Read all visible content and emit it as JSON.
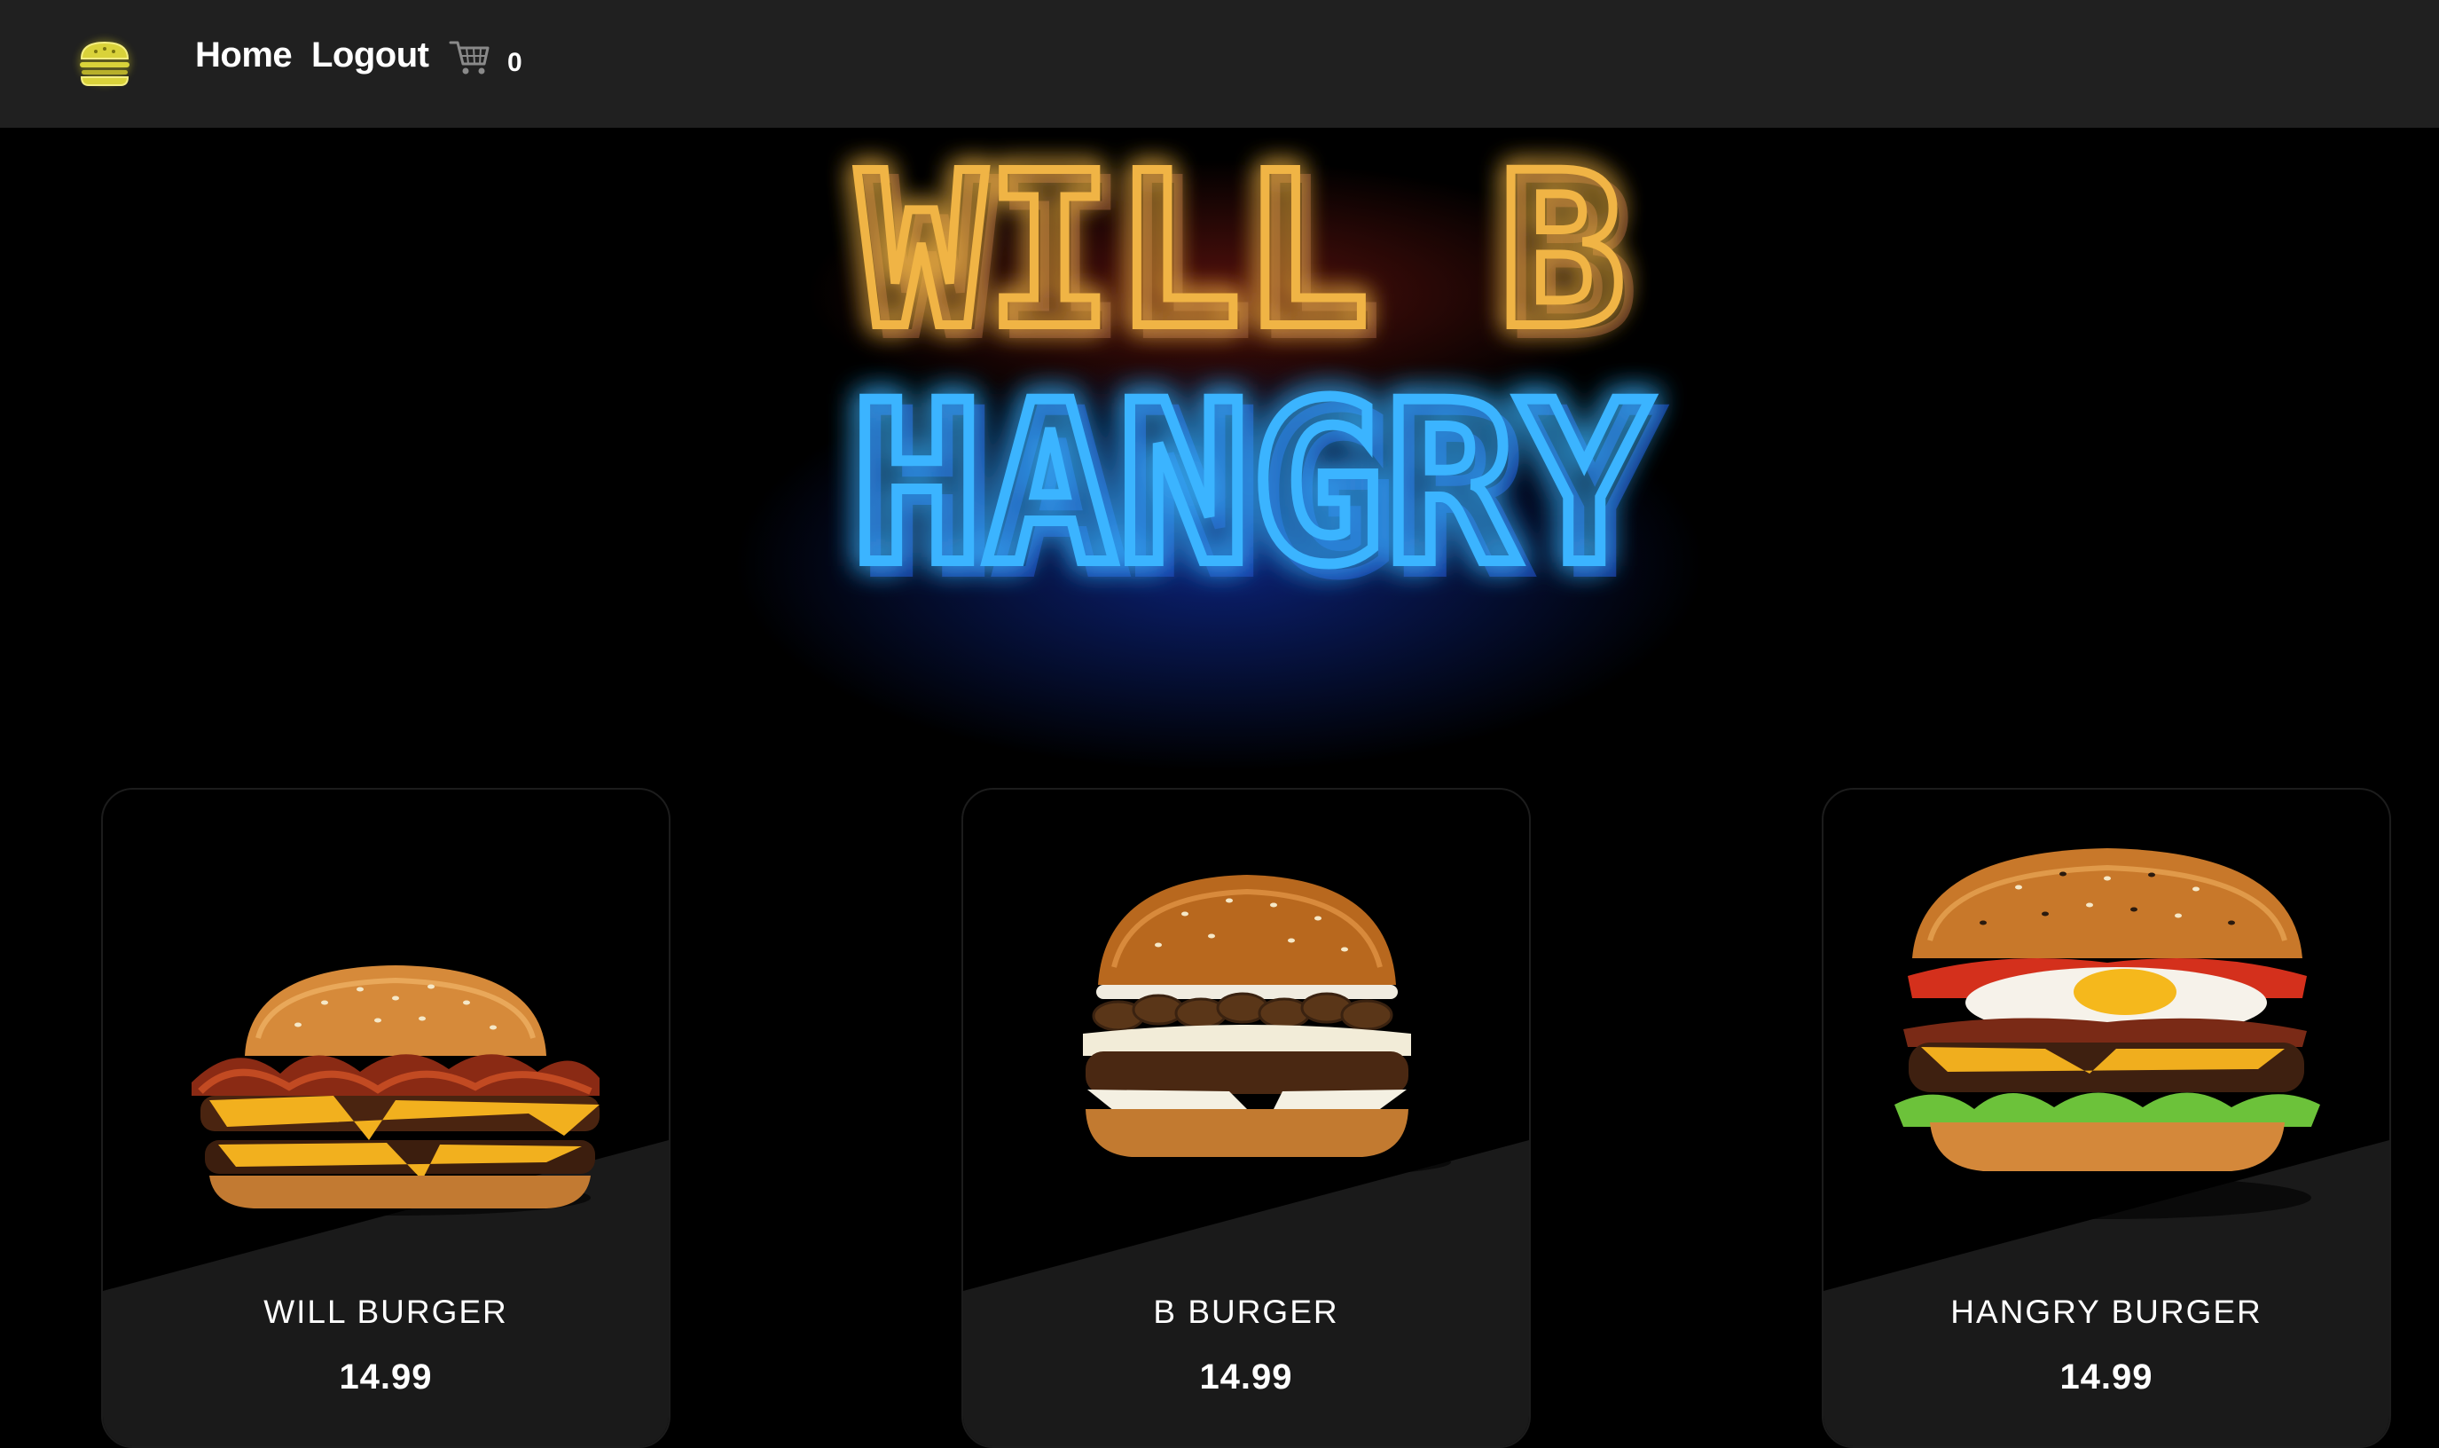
{
  "nav": {
    "logo_icon": "burger-icon",
    "home_label": "Home",
    "logout_label": "Logout",
    "cart_icon": "shopping-cart-icon",
    "cart_count": "0"
  },
  "hero": {
    "line1": "WILL B",
    "line2": "HANGRY",
    "line1_color": "#f0b444",
    "line1_glow": "#e0301e",
    "line2_color": "#3ab4ff",
    "line2_glow": "#1448ff"
  },
  "products": [
    {
      "name": "WILL BURGER",
      "price": "14.99"
    },
    {
      "name": "B BURGER",
      "price": "14.99"
    },
    {
      "name": "HANGRY BURGER",
      "price": "14.99"
    }
  ],
  "colors": {
    "navbar_bg": "#202020",
    "page_bg": "#000000",
    "card_panel": "#1a1a1a",
    "logo_yellow": "#e8e04a"
  }
}
